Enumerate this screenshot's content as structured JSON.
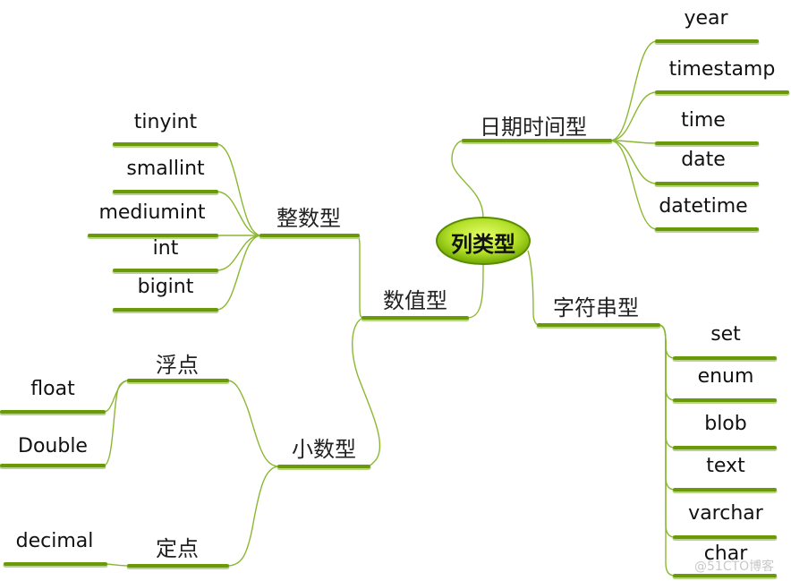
{
  "root": {
    "label": "列类型"
  },
  "colors": {
    "bar": "#6a9a0a",
    "bar_shadow": "#b8d48a",
    "link": "#8bb832",
    "root_fill_center": "#d8f25a",
    "root_fill_edge": "#7bb800",
    "root_stroke": "#4a7a00"
  },
  "branches": {
    "datetime": {
      "label": "日期时间型",
      "children": [
        "year",
        "timestamp",
        "time",
        "date",
        "datetime"
      ]
    },
    "numeric": {
      "label": "数值型",
      "integer": {
        "label": "整数型",
        "children": [
          "tinyint",
          "smallint",
          "mediumint",
          "int",
          "bigint"
        ]
      },
      "decimal": {
        "label": "小数型",
        "float_point": {
          "label": "浮点",
          "children": [
            "float",
            "Double"
          ]
        },
        "fixed_point": {
          "label": "定点",
          "children": [
            "decimal"
          ]
        }
      }
    },
    "string": {
      "label": "字符串型",
      "children": [
        "set",
        "enum",
        "blob",
        "text",
        "varchar",
        "char"
      ]
    }
  },
  "watermark": "@51CTO博客"
}
